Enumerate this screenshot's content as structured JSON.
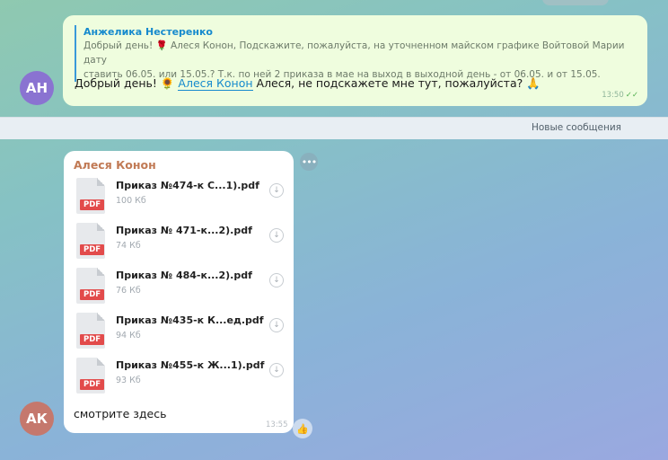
{
  "outgoing": {
    "avatar_initials": "АН",
    "avatar_color": "#8a73d1",
    "reply_name": "Анжелика Нестеренко",
    "reply_text_line1": "Добрый день! 🌹 Алеся Конон, Подскажите, пожалуйста, на уточненном майском графике Войтовой Марии дату",
    "reply_text_line2": "ставить 06.05. или 15.05.? Т.к. по ней 2 приказа в мае на выход в выходной день - от 06.05. и от 15.05.",
    "text_before": "Добрый день! 🌻 ",
    "mention": "Алеся Конон",
    "text_after": " Алеся, не подскажете мне тут, пожалуйста? 🙏",
    "time": "13:50",
    "status_icon": "double-check-icon"
  },
  "new_messages_label": "Новые сообщения",
  "incoming": {
    "avatar_initials": "АК",
    "avatar_color": "#c5786d",
    "sender": "Алеся Конон",
    "files": [
      {
        "name": "Приказ №474-к С...1).pdf",
        "size": "100 Кб",
        "badge": "PDF"
      },
      {
        "name": "Приказ № 471-к...2).pdf",
        "size": "74 Кб",
        "badge": "PDF"
      },
      {
        "name": "Приказ № 484-к...2).pdf",
        "size": "76 Кб",
        "badge": "PDF"
      },
      {
        "name": "Приказ №435-к К...ед.pdf",
        "size": "94 Кб",
        "badge": "PDF"
      },
      {
        "name": "Приказ №455-к Ж...1).pdf",
        "size": "93 Кб",
        "badge": "PDF"
      }
    ],
    "caption": "смотрите здесь",
    "time": "13:55"
  },
  "icons": {
    "download": "download-icon",
    "more": "more-icon",
    "reaction": "reaction-icon"
  }
}
